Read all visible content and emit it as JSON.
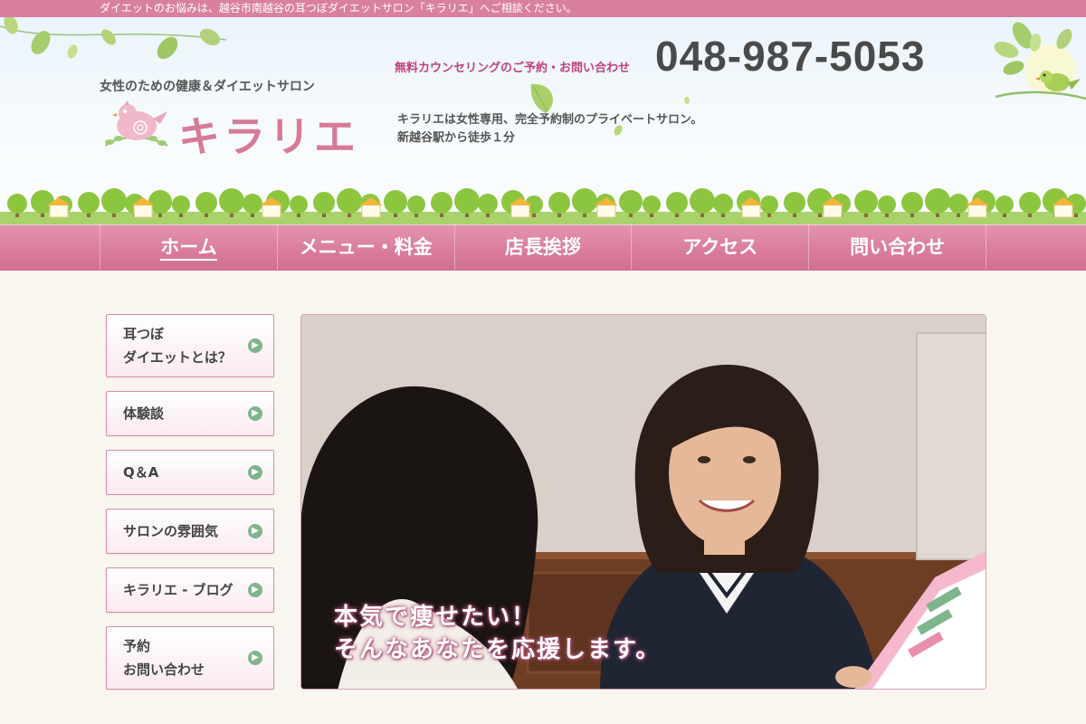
{
  "topbar": {
    "text": "ダイエットのお悩みは、越谷市南越谷の耳つぼダイエットサロン「キラリエ」へご相談ください。"
  },
  "header": {
    "tagline": "女性のための健康＆ダイエットサロン",
    "logo": "キラリエ",
    "contact_label": "無料カウンセリングのご予約・お問い合わせ",
    "phone": "048-987-5053",
    "desc_line1": "キラリエは女性専用、完全予約制のプライベートサロン。",
    "desc_line2": "新越谷駅から徒歩１分"
  },
  "nav": {
    "items": [
      {
        "label": "ホーム",
        "active": true
      },
      {
        "label": "メニュー・料金"
      },
      {
        "label": "店長挨拶"
      },
      {
        "label": "アクセス"
      },
      {
        "label": "問い合わせ"
      }
    ]
  },
  "sidebar": {
    "items": [
      {
        "line1": "耳つぼ",
        "line2": "ダイエットとは？"
      },
      {
        "line1": "体験談"
      },
      {
        "line1": "Q＆A"
      },
      {
        "line1": "サロンの雰囲気"
      },
      {
        "line1": "キラリエ - ブログ"
      },
      {
        "line1": "予約",
        "line2": "お問い合わせ"
      }
    ]
  },
  "hero": {
    "caption_line1": "本気で痩せたい！",
    "caption_line2": "そんなあなたを応援します。",
    "slides": 2,
    "current_slide": 1
  },
  "colors": {
    "brand_pink": "#d77a98",
    "nav_pink": "#d97a9c",
    "accent_green": "#7fb58b",
    "contact_label": "#c2417a"
  }
}
